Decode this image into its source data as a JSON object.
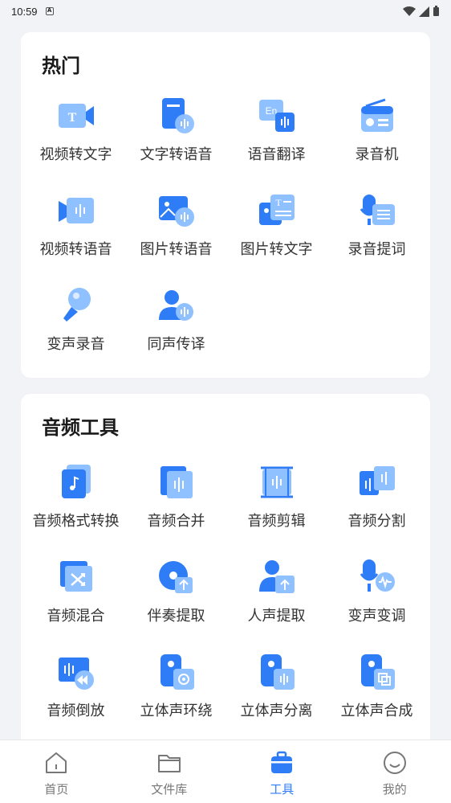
{
  "status_bar": {
    "time": "10:59",
    "badge": "A"
  },
  "hot": {
    "title": "热门",
    "tools": [
      {
        "label": "视频转文字",
        "icon": "video-to-text-icon"
      },
      {
        "label": "文字转语音",
        "icon": "text-to-speech-icon"
      },
      {
        "label": "语音翻译",
        "icon": "voice-translate-icon"
      },
      {
        "label": "录音机",
        "icon": "recorder-icon"
      },
      {
        "label": "视频转语音",
        "icon": "video-to-audio-icon"
      },
      {
        "label": "图片转语音",
        "icon": "image-to-speech-icon"
      },
      {
        "label": "图片转文字",
        "icon": "image-to-text-icon"
      },
      {
        "label": "录音提词",
        "icon": "teleprompter-icon"
      },
      {
        "label": "变声录音",
        "icon": "voice-change-record-icon"
      },
      {
        "label": "同声传译",
        "icon": "simultaneous-interpretation-icon"
      }
    ]
  },
  "audio": {
    "title": "音频工具",
    "tools": [
      {
        "label": "音频格式转换",
        "icon": "audio-format-convert-icon"
      },
      {
        "label": "音频合并",
        "icon": "audio-merge-icon"
      },
      {
        "label": "音频剪辑",
        "icon": "audio-cut-icon"
      },
      {
        "label": "音频分割",
        "icon": "audio-split-icon"
      },
      {
        "label": "音频混合",
        "icon": "audio-mix-icon"
      },
      {
        "label": "伴奏提取",
        "icon": "accompaniment-extract-icon"
      },
      {
        "label": "人声提取",
        "icon": "vocal-extract-icon"
      },
      {
        "label": "变声变调",
        "icon": "voice-pitch-icon"
      },
      {
        "label": "音频倒放",
        "icon": "audio-reverse-icon"
      },
      {
        "label": "立体声环绕",
        "icon": "stereo-surround-icon"
      },
      {
        "label": "立体声分离",
        "icon": "stereo-separate-icon"
      },
      {
        "label": "立体声合成",
        "icon": "stereo-combine-icon"
      }
    ]
  },
  "nav": {
    "items": [
      {
        "label": "首页",
        "icon": "home-icon",
        "active": false
      },
      {
        "label": "文件库",
        "icon": "folder-icon",
        "active": false
      },
      {
        "label": "工具",
        "icon": "toolbox-icon",
        "active": true
      },
      {
        "label": "我的",
        "icon": "profile-icon",
        "active": false
      }
    ]
  },
  "colors": {
    "accent": "#2f7df6",
    "accent_light": "#8fc0ff",
    "bg": "#f2f3f7"
  }
}
